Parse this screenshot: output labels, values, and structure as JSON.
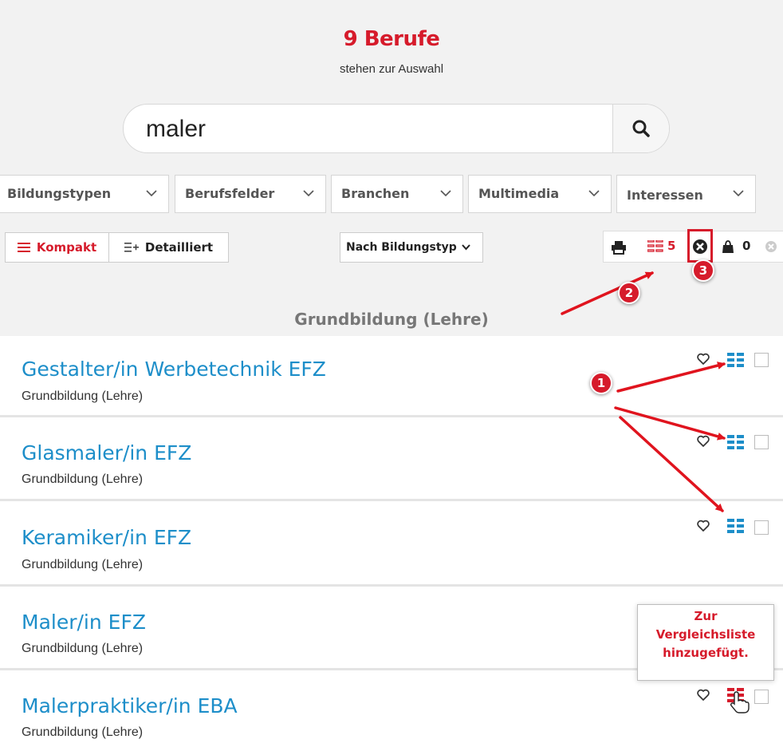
{
  "header": {
    "count_title": "9 Berufe",
    "subtitle": "stehen zur Auswahl"
  },
  "search": {
    "value": "maler"
  },
  "filters": [
    "Bildungstypen",
    "Berufsfelder",
    "Branchen",
    "Multimedia",
    "Interessen"
  ],
  "view": {
    "compact_label": "Kompakt",
    "detailed_label": "Detailliert",
    "sort_label": "Nach Bildungstyp"
  },
  "tools": {
    "compare_count": "5",
    "bag_count": "0"
  },
  "section_title": "Grundbildung (Lehre)",
  "results": [
    {
      "title": "Gestalter/in Werbetechnik EFZ",
      "type": "Grundbildung (Lehre)"
    },
    {
      "title": "Glasmaler/in EFZ",
      "type": "Grundbildung (Lehre)"
    },
    {
      "title": "Keramiker/in EFZ",
      "type": "Grundbildung (Lehre)"
    },
    {
      "title": "Maler/in EFZ",
      "type": "Grundbildung (Lehre)"
    },
    {
      "title": "Malerpraktiker/in EBA",
      "type": "Grundbildung (Lehre)"
    }
  ],
  "tooltip": {
    "line1": "Zur",
    "line2": "Vergleichsliste",
    "line3": "hinzugefügt."
  },
  "annotations": {
    "badge1": "1",
    "badge2": "2",
    "badge3": "3"
  },
  "colors": {
    "accent_red": "#d61b2b",
    "link_blue": "#1d8ec9",
    "compare_blue": "#1d8ec9"
  }
}
